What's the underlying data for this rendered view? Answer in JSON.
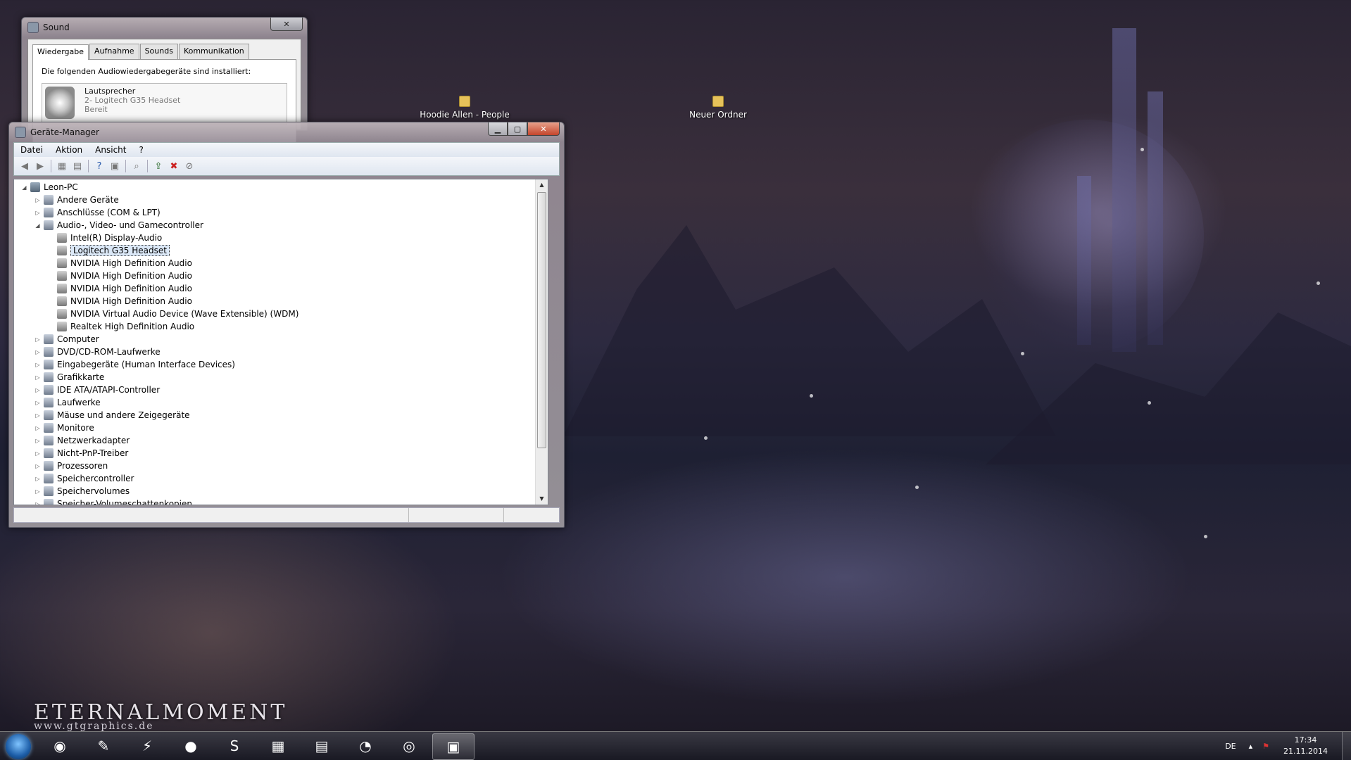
{
  "desktop": {
    "icons": [
      {
        "label": "Hoodie Allen - People"
      },
      {
        "label": "Neuer Ordner"
      }
    ],
    "watermark": "ETERNALMOMENT",
    "watermark_sub": "www.gtgraphics.de"
  },
  "sound_dialog": {
    "title": "Sound",
    "close_label": "✕",
    "tabs": [
      "Wiedergabe",
      "Aufnahme",
      "Sounds",
      "Kommunikation"
    ],
    "intro": "Die folgenden Audiowiedergabegeräte sind installiert:",
    "device": {
      "name": "Lautsprecher",
      "desc": "2- Logitech G35 Headset",
      "status": "Bereit"
    }
  },
  "device_manager": {
    "title": "Geräte-Manager",
    "menu": [
      "Datei",
      "Aktion",
      "Ansicht",
      "?"
    ],
    "tree": [
      {
        "label": "Leon-PC",
        "level": 0,
        "expander": "◢",
        "icon": "computer-icon"
      },
      {
        "label": "Andere Geräte",
        "level": 1,
        "expander": "▷",
        "icon": "unknown-device-icon"
      },
      {
        "label": "Anschlüsse (COM & LPT)",
        "level": 1,
        "expander": "▷",
        "icon": "port-icon"
      },
      {
        "label": "Audio-, Video- und Gamecontroller",
        "level": 1,
        "expander": "◢",
        "icon": "speaker-icon"
      },
      {
        "label": "Intel(R) Display-Audio",
        "level": 2,
        "expander": "",
        "icon": "speaker-icon"
      },
      {
        "label": "Logitech G35 Headset",
        "level": 2,
        "expander": "",
        "icon": "speaker-icon",
        "selected": true
      },
      {
        "label": "NVIDIA High Definition Audio",
        "level": 2,
        "expander": "",
        "icon": "speaker-icon"
      },
      {
        "label": "NVIDIA High Definition Audio",
        "level": 2,
        "expander": "",
        "icon": "speaker-icon"
      },
      {
        "label": "NVIDIA High Definition Audio",
        "level": 2,
        "expander": "",
        "icon": "speaker-icon"
      },
      {
        "label": "NVIDIA High Definition Audio",
        "level": 2,
        "expander": "",
        "icon": "speaker-icon"
      },
      {
        "label": "NVIDIA Virtual Audio Device (Wave Extensible) (WDM)",
        "level": 2,
        "expander": "",
        "icon": "speaker-icon"
      },
      {
        "label": "Realtek High Definition Audio",
        "level": 2,
        "expander": "",
        "icon": "speaker-icon"
      },
      {
        "label": "Computer",
        "level": 1,
        "expander": "▷",
        "icon": "monitor-icon"
      },
      {
        "label": "DVD/CD-ROM-Laufwerke",
        "level": 1,
        "expander": "▷",
        "icon": "disc-drive-icon"
      },
      {
        "label": "Eingabegeräte (Human Interface Devices)",
        "level": 1,
        "expander": "▷",
        "icon": "hid-icon"
      },
      {
        "label": "Grafikkarte",
        "level": 1,
        "expander": "▷",
        "icon": "display-adapter-icon"
      },
      {
        "label": "IDE ATA/ATAPI-Controller",
        "level": 1,
        "expander": "▷",
        "icon": "controller-icon"
      },
      {
        "label": "Laufwerke",
        "level": 1,
        "expander": "▷",
        "icon": "disk-drive-icon"
      },
      {
        "label": "Mäuse und andere Zeigegeräte",
        "level": 1,
        "expander": "▷",
        "icon": "mouse-icon"
      },
      {
        "label": "Monitore",
        "level": 1,
        "expander": "▷",
        "icon": "monitor-icon"
      },
      {
        "label": "Netzwerkadapter",
        "level": 1,
        "expander": "▷",
        "icon": "network-icon"
      },
      {
        "label": "Nicht-PnP-Treiber",
        "level": 1,
        "expander": "▷",
        "icon": "driver-icon"
      },
      {
        "label": "Prozessoren",
        "level": 1,
        "expander": "▷",
        "icon": "cpu-icon"
      },
      {
        "label": "Speichercontroller",
        "level": 1,
        "expander": "▷",
        "icon": "storage-controller-icon"
      },
      {
        "label": "Speichervolumes",
        "level": 1,
        "expander": "▷",
        "icon": "volume-icon"
      },
      {
        "label": "Speicher-Volumeschattenkopien",
        "level": 1,
        "expander": "▷",
        "icon": "shadow-copy-icon"
      }
    ]
  },
  "taskbar": {
    "apps": [
      {
        "name": "steam-icon",
        "glyph": "◉"
      },
      {
        "name": "control-panel-icon",
        "glyph": "✎"
      },
      {
        "name": "winamp-icon",
        "glyph": "⚡"
      },
      {
        "name": "firefox-icon",
        "glyph": "●"
      },
      {
        "name": "skype-icon",
        "glyph": "S"
      },
      {
        "name": "remote-desktop-icon",
        "glyph": "▦"
      },
      {
        "name": "explorer-icon",
        "glyph": "▤"
      },
      {
        "name": "media-player-icon",
        "glyph": "◔"
      },
      {
        "name": "disc-icon",
        "glyph": "◎"
      },
      {
        "name": "device-manager-icon",
        "glyph": "▣"
      }
    ],
    "language": "DE",
    "time": "17:34",
    "date": "21.11.2014"
  },
  "colors": {
    "accent": "#dbe8f7",
    "close_red": "#c4452c"
  }
}
